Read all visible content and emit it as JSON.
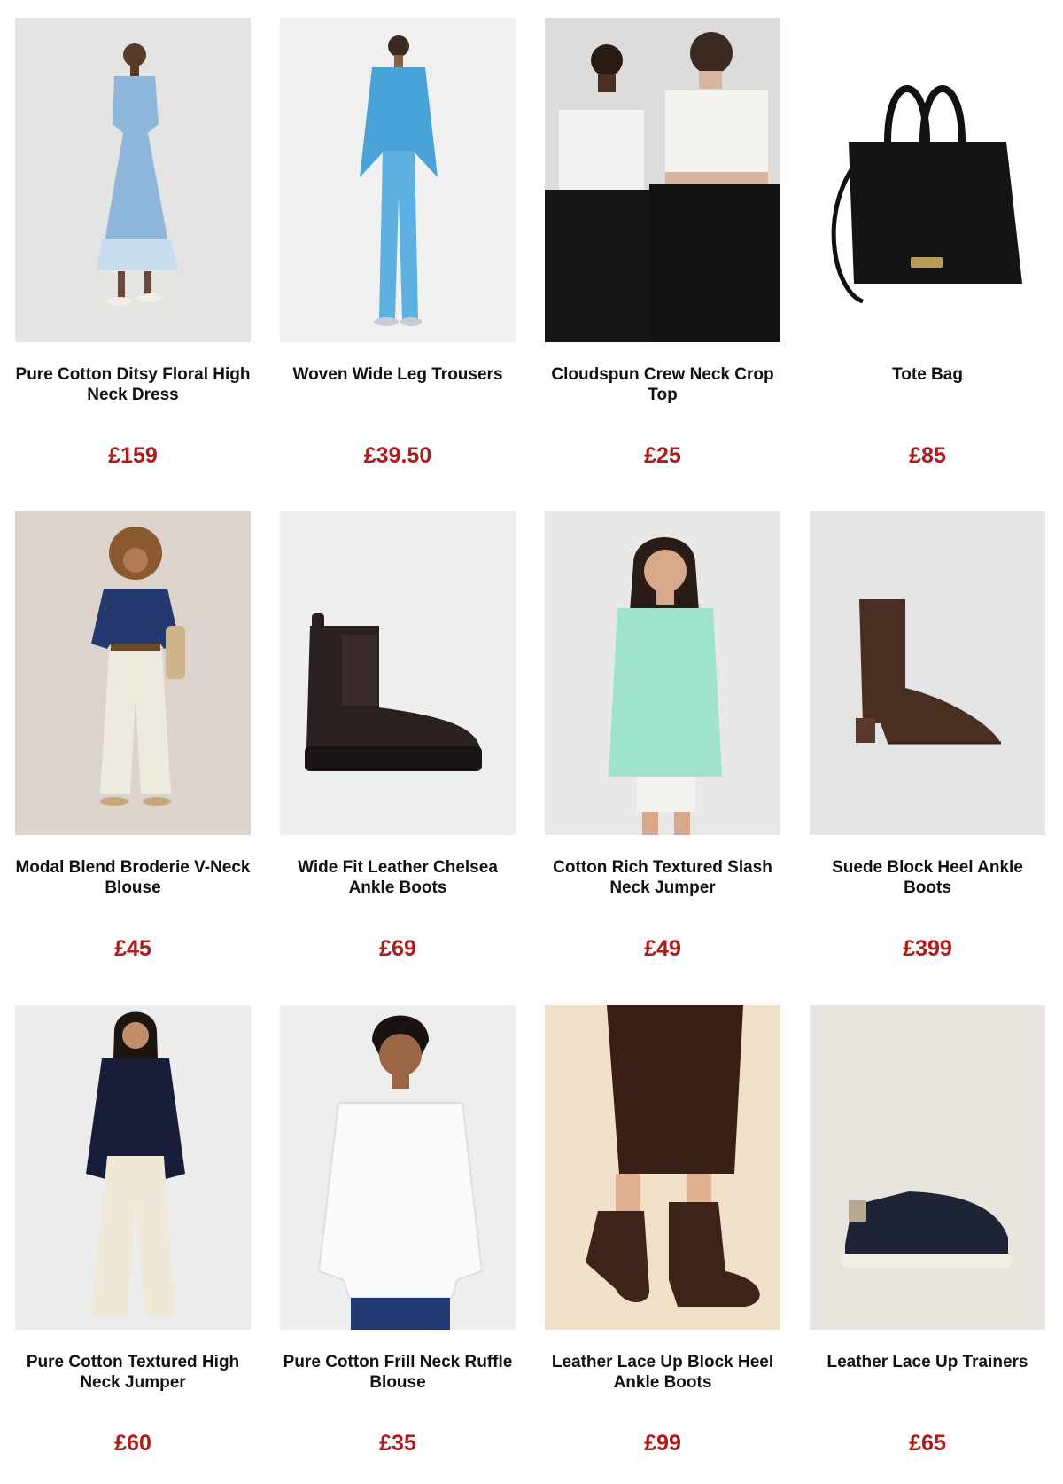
{
  "price_color": "#b01a1a",
  "products": [
    {
      "name": "Pure Cotton Ditsy Floral High Neck Dress",
      "price": "£159",
      "image": "floral-dress-photo"
    },
    {
      "name": "Woven Wide Leg Trousers",
      "price": "£39.50",
      "image": "blue-suit-photo"
    },
    {
      "name": "Cloudspun Crew Neck Crop Top",
      "price": "£25",
      "image": "crop-top-models-photo"
    },
    {
      "name": "Tote Bag",
      "price": "£85",
      "image": "black-tote-bag-photo"
    },
    {
      "name": "Modal Blend Broderie V-Neck Blouse",
      "price": "£45",
      "image": "navy-blouse-photo"
    },
    {
      "name": "Wide Fit Leather Chelsea Ankle Boots",
      "price": "£69",
      "image": "chelsea-boot-photo"
    },
    {
      "name": "Cotton Rich Textured Slash Neck Jumper",
      "price": "£49",
      "image": "mint-jumper-photo"
    },
    {
      "name": "Suede Block Heel Ankle Boots",
      "price": "£399",
      "image": "suede-boot-photo"
    },
    {
      "name": "Pure Cotton Textured High Neck Jumper",
      "price": "£60",
      "image": "navy-jumper-photo"
    },
    {
      "name": "Pure Cotton Frill Neck Ruffle Blouse",
      "price": "£35",
      "image": "white-ruffle-blouse-photo"
    },
    {
      "name": "Leather Lace Up Block Heel Ankle Boots",
      "price": "£99",
      "image": "lace-up-boots-photo"
    },
    {
      "name": "Leather Lace Up Trainers",
      "price": "£65",
      "image": "navy-trainer-photo"
    }
  ]
}
